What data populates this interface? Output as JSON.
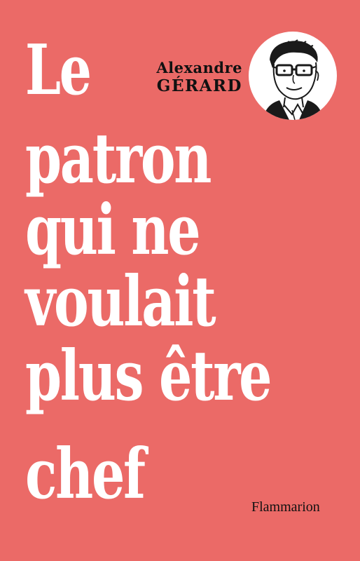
{
  "cover": {
    "background_color": "#eb6a67",
    "text_color": "#ffffff",
    "accent_text_color": "#111111"
  },
  "author": {
    "first_name": "Alexandre",
    "last_name": "GÉRARD",
    "portrait_icon": "author-portrait-illustration"
  },
  "title": {
    "lines": [
      "Le",
      "patron",
      "qui ne",
      "voulait",
      "plus être",
      "chef"
    ]
  },
  "publisher": {
    "name": "Flammarion"
  }
}
